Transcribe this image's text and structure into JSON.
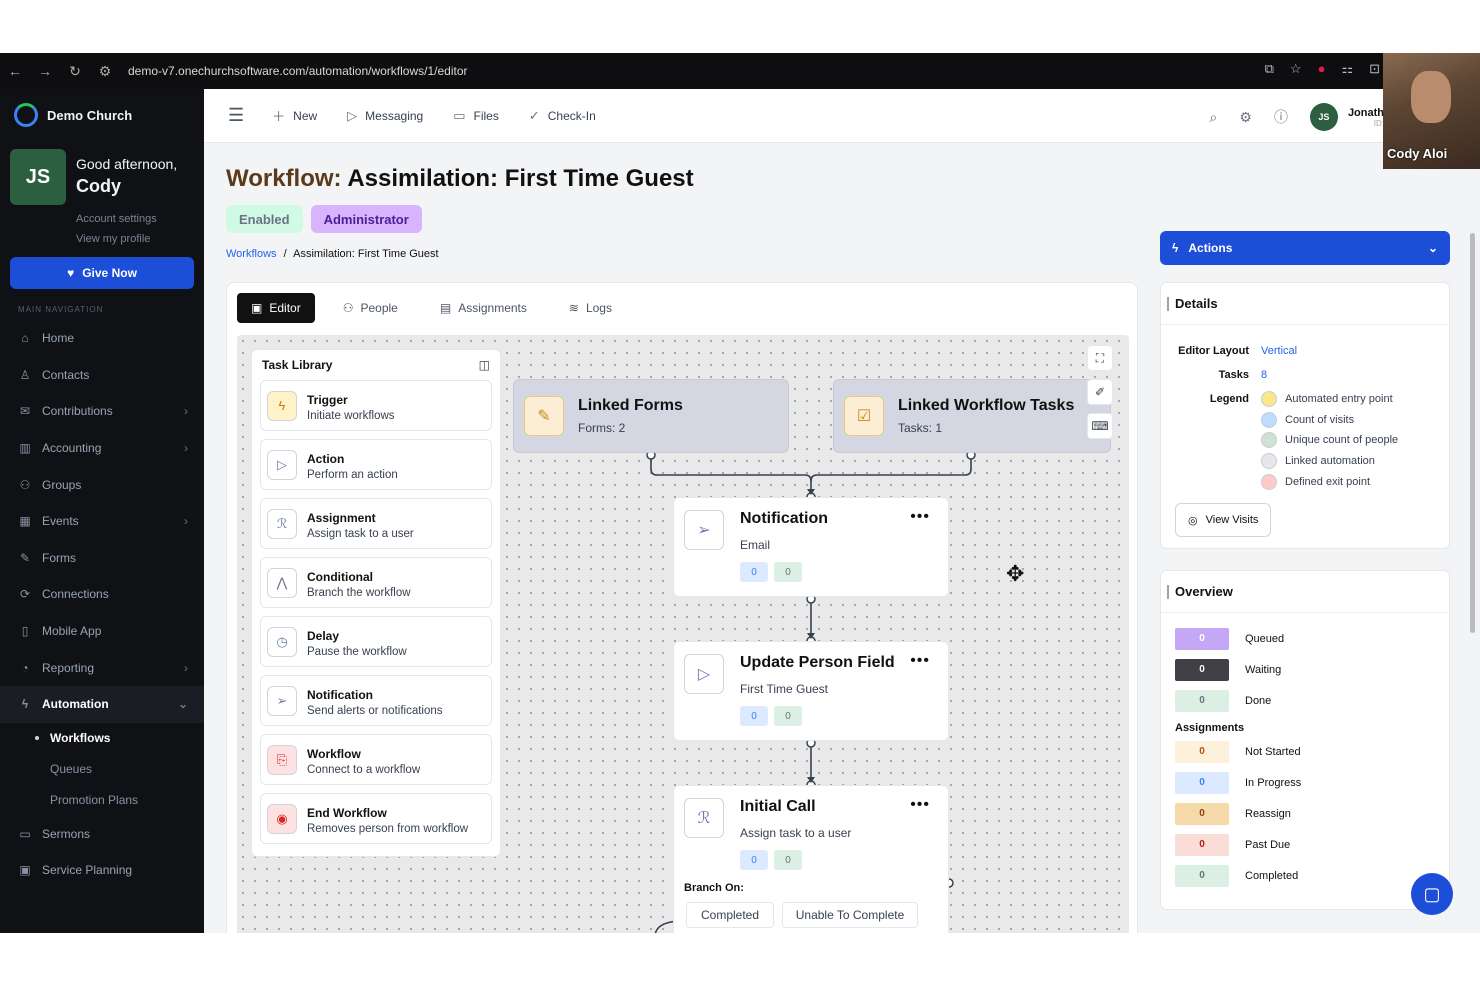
{
  "browser": {
    "url": "demo-v7.onechurchsoftware.com/automation/workflows/1/editor"
  },
  "sidebar": {
    "org": "Demo Church",
    "avatar": "JS",
    "greeting": "Good afternoon,",
    "user": "Cody",
    "account_settings": "Account settings",
    "view_profile": "View my profile",
    "give_now": "Give Now",
    "nav_header": "MAIN NAVIGATION",
    "items": [
      {
        "label": "Home",
        "icon": "home-icon"
      },
      {
        "label": "Contacts",
        "icon": "user-icon"
      },
      {
        "label": "Contributions",
        "icon": "mail-icon",
        "chevron": true
      },
      {
        "label": "Accounting",
        "icon": "ledger-icon",
        "chevron": true
      },
      {
        "label": "Groups",
        "icon": "group-icon"
      },
      {
        "label": "Events",
        "icon": "calendar-icon",
        "chevron": true
      },
      {
        "label": "Forms",
        "icon": "form-icon"
      },
      {
        "label": "Connections",
        "icon": "link-icon"
      },
      {
        "label": "Mobile App",
        "icon": "phone-icon"
      },
      {
        "label": "Reporting",
        "icon": "chart-icon",
        "chevron": true
      },
      {
        "label": "Automation",
        "icon": "lightning-icon",
        "chevron": true,
        "active": true
      }
    ],
    "sub_items": [
      "Workflows",
      "Queues",
      "Promotion Plans"
    ],
    "items_after": [
      {
        "label": "Sermons",
        "icon": "monitor-icon"
      },
      {
        "label": "Service Planning",
        "icon": "planning-icon"
      }
    ]
  },
  "topbar": {
    "new": "New",
    "messaging": "Messaging",
    "files": "Files",
    "checkin": "Check-In",
    "user_initials": "JS",
    "user_name": "Jonath",
    "user_sub": "ID:"
  },
  "video": {
    "name": "Cody Aloi"
  },
  "header": {
    "prefix": "Workflow:",
    "title": "Assimilation: First Time Guest",
    "badge_enabled": "Enabled",
    "badge_admin": "Administrator"
  },
  "breadcrumb": {
    "root": "Workflows",
    "sep": "/",
    "current": "Assimilation: First Time Guest"
  },
  "tabs": {
    "editor": "Editor",
    "people": "People",
    "assignments": "Assignments",
    "logs": "Logs"
  },
  "library": {
    "title": "Task Library",
    "items": [
      {
        "name": "Trigger",
        "desc": "Initiate workflows",
        "glyph": "ϟ",
        "color": "#d97706",
        "bg": "#fef3c7"
      },
      {
        "name": "Action",
        "desc": "Perform an action",
        "glyph": "▷",
        "color": "#6b7eaa",
        "bg": "#fff"
      },
      {
        "name": "Assignment",
        "desc": "Assign task to a user",
        "glyph": "ℛ",
        "color": "#6b7eaa",
        "bg": "#fff"
      },
      {
        "name": "Conditional",
        "desc": "Branch the workflow",
        "glyph": "⋀",
        "color": "#6b7280",
        "bg": "#fff"
      },
      {
        "name": "Delay",
        "desc": "Pause the workflow",
        "glyph": "◷",
        "color": "#6b7eaa",
        "bg": "#fff"
      },
      {
        "name": "Notification",
        "desc": "Send alerts or notifications",
        "glyph": "➢",
        "color": "#6b7eaa",
        "bg": "#fff"
      },
      {
        "name": "Workflow",
        "desc": "Connect to a workflow",
        "glyph": "⎘",
        "color": "#dc2626",
        "bg": "#fee2e2"
      },
      {
        "name": "End Workflow",
        "desc": "Removes person from workflow",
        "glyph": "◉",
        "color": "#dc2626",
        "bg": "#fee2e2"
      }
    ]
  },
  "linked": {
    "forms": {
      "title": "Linked Forms",
      "sub": "Forms: 2"
    },
    "tasks": {
      "title": "Linked Workflow Tasks",
      "sub": "Tasks: 1"
    }
  },
  "nodes": [
    {
      "title": "Notification",
      "sub": "Email",
      "a": "0",
      "b": "0"
    },
    {
      "title": "Update Person Field",
      "sub": "First Time Guest",
      "a": "0",
      "b": "0"
    },
    {
      "title": "Initial Call",
      "sub": "Assign task to a user",
      "a": "0",
      "b": "0"
    }
  ],
  "branch": {
    "label": "Branch On:",
    "opt1": "Completed",
    "opt2": "Unable To Complete"
  },
  "actions": {
    "label": "Actions"
  },
  "details": {
    "title": "Details",
    "layout_label": "Editor Layout",
    "layout_value": "Vertical",
    "tasks_label": "Tasks",
    "tasks_value": "8",
    "legend_label": "Legend",
    "legend": [
      {
        "label": "Automated entry point",
        "color": "#fde68a"
      },
      {
        "label": "Count of visits",
        "color": "#bfdbfe"
      },
      {
        "label": "Unique count of people",
        "color": "#cfe0d4"
      },
      {
        "label": "Linked automation",
        "color": "#e5e7eb"
      },
      {
        "label": "Defined exit point",
        "color": "#fecaca"
      }
    ],
    "view_visits": "View Visits"
  },
  "overview": {
    "title": "Overview",
    "status": [
      {
        "label": "Queued",
        "value": "0",
        "bg": "#c4a7f5",
        "fg": "#fff"
      },
      {
        "label": "Waiting",
        "value": "0",
        "bg": "#3f3f46",
        "fg": "#fff"
      },
      {
        "label": "Done",
        "value": "0",
        "bg": "#dcefe4",
        "fg": "#6b7280"
      }
    ],
    "assign_title": "Assignments",
    "assign": [
      {
        "label": "Not Started",
        "value": "0",
        "bg": "#fdf1dc",
        "fg": "#b45309"
      },
      {
        "label": "In Progress",
        "value": "0",
        "bg": "#dbeafe",
        "fg": "#3b82f6"
      },
      {
        "label": "Reassign",
        "value": "0",
        "bg": "#f5d9a8",
        "fg": "#92400e"
      },
      {
        "label": "Past Due",
        "value": "0",
        "bg": "#f9ddd6",
        "fg": "#b91c1c"
      },
      {
        "label": "Completed",
        "value": "0",
        "bg": "#dcefe4",
        "fg": "#6b7280"
      }
    ]
  }
}
